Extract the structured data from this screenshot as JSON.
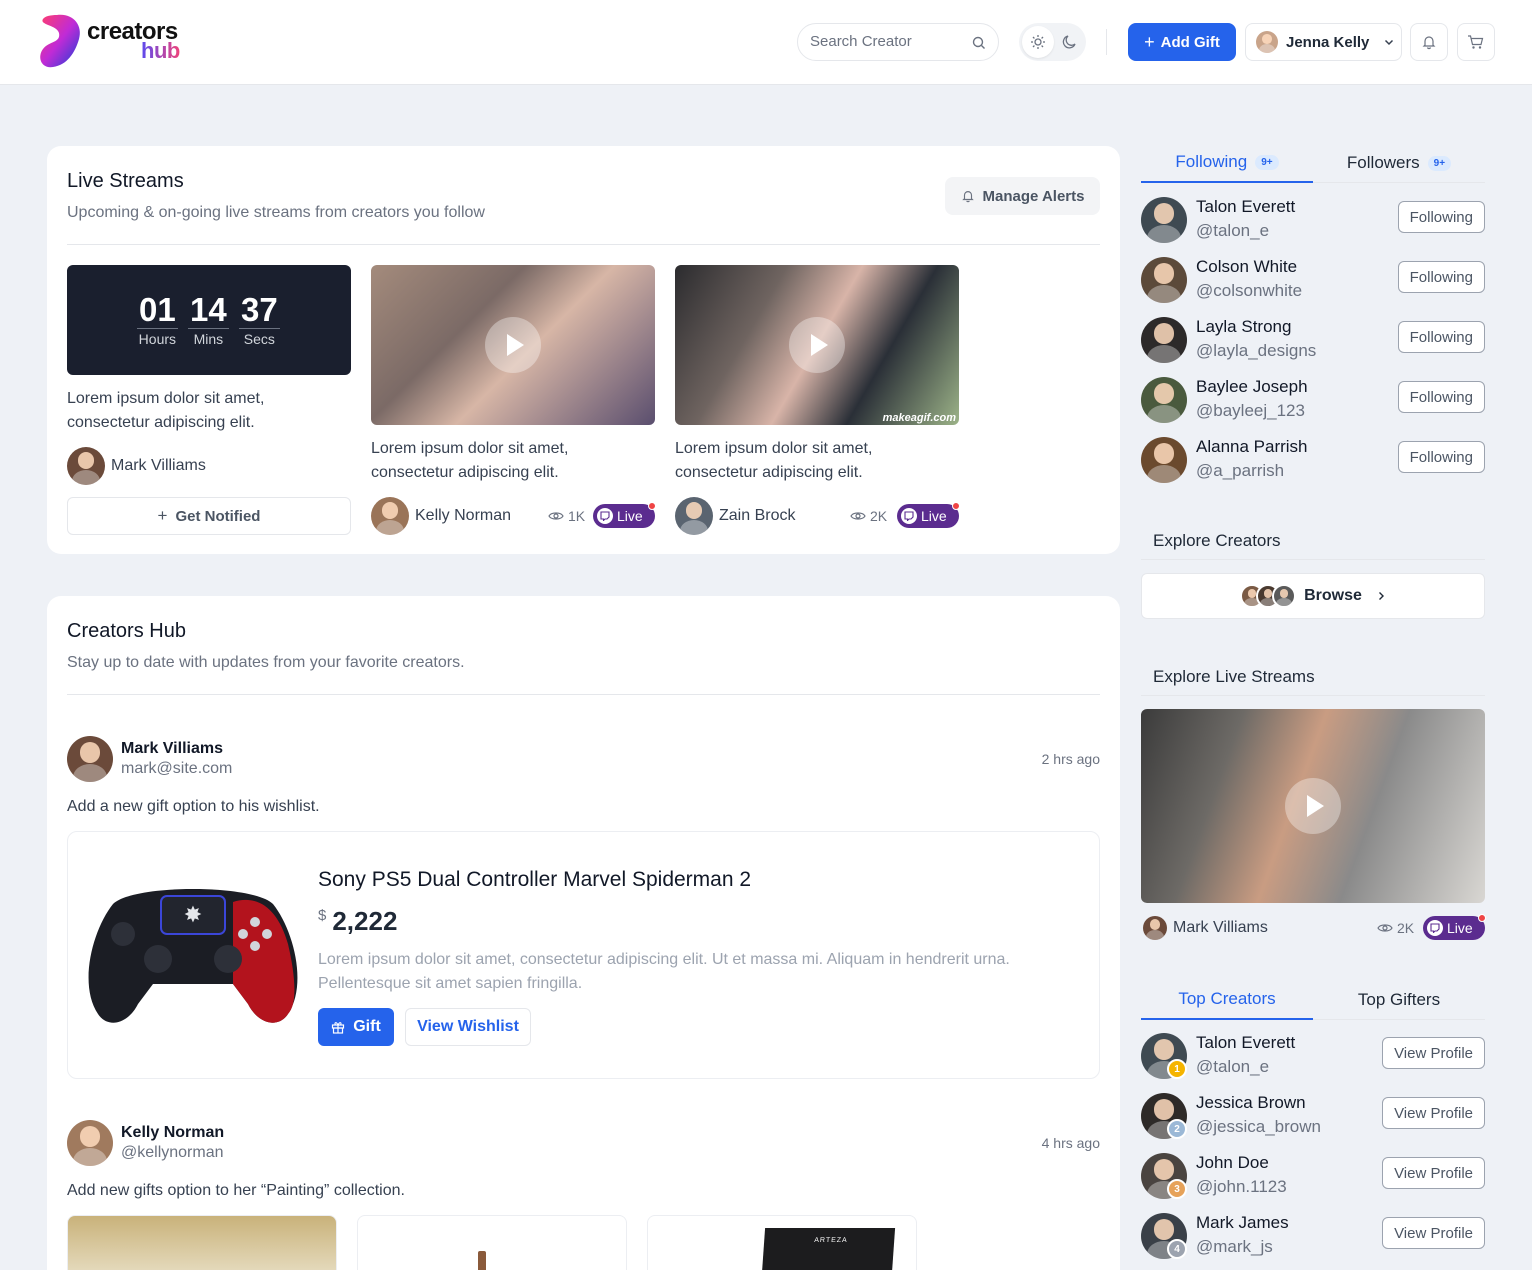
{
  "header": {
    "logo_line1": "creators",
    "logo_line2": "hub",
    "search_placeholder": "Search Creator",
    "add_gift_label": "Add Gift",
    "user_name": "Jenna Kelly",
    "icons": [
      "search-icon",
      "sun-icon",
      "moon-icon",
      "plus-icon",
      "chevron-down-icon",
      "bell-icon",
      "cart-icon"
    ]
  },
  "live_streams": {
    "title": "Live Streams",
    "subtitle": "Upcoming & on-going live streams from creators you follow",
    "manage_alerts_label": "Manage Alerts",
    "countdown": {
      "hours": "01",
      "mins": "14",
      "secs": "37",
      "hours_label": "Hours",
      "mins_label": "Mins",
      "secs_label": "Secs"
    },
    "upcoming": {
      "desc": "Lorem ipsum dolor sit amet, consectetur adipiscing elit.",
      "creator": "Mark Villiams",
      "notify_label": "Get Notified"
    },
    "streams": [
      {
        "desc": "Lorem ipsum dolor sit amet, consectetur adipiscing elit.",
        "creator": "Kelly Norman",
        "views": "1K",
        "live_label": "Live"
      },
      {
        "desc": "Lorem ipsum dolor sit amet, consectetur adipiscing elit.",
        "creator": "Zain Brock",
        "views": "2K",
        "live_label": "Live",
        "watermark": "makeagif.com"
      }
    ]
  },
  "creators_hub": {
    "title": "Creators Hub",
    "subtitle": "Stay up to date with updates from your favorite creators.",
    "posts": [
      {
        "name": "Mark Villiams",
        "handle": "mark@site.com",
        "time": "2 hrs ago",
        "text": "Add a new gift option to his wishlist.",
        "product": {
          "title": "Sony PS5 Dual Controller Marvel Spiderman 2",
          "currency": "$",
          "price": "2,222",
          "desc": "Lorem ipsum dolor sit amet, consectetur adipiscing elit. Ut et massa mi. Aliquam in hendrerit urna. Pellentesque sit amet sapien fringilla.",
          "gift_label": "Gift",
          "wishlist_label": "View Wishlist"
        }
      },
      {
        "name": "Kelly Norman",
        "handle": "@kellynorman",
        "time": "4 hrs ago",
        "text": "Add new gifts option to her “Painting” collection.",
        "gallery_text": "ARTEZA"
      }
    ]
  },
  "sidebar": {
    "tabs": [
      {
        "label": "Following",
        "count": "9+"
      },
      {
        "label": "Followers",
        "count": "9+"
      }
    ],
    "following": [
      {
        "name": "Talon Everett",
        "handle": "@talon_e",
        "button": "Following"
      },
      {
        "name": "Colson White",
        "handle": "@colsonwhite",
        "button": "Following"
      },
      {
        "name": "Layla Strong",
        "handle": "@layla_designs",
        "button": "Following"
      },
      {
        "name": "Baylee Joseph",
        "handle": "@bayleej_123",
        "button": "Following"
      },
      {
        "name": "Alanna Parrish",
        "handle": "@a_parrish",
        "button": "Following"
      }
    ],
    "explore_creators_title": "Explore Creators",
    "browse_label": "Browse",
    "explore_streams_title": "Explore Live Streams",
    "featured_stream": {
      "creator": "Mark Villiams",
      "views": "2K",
      "live_label": "Live"
    },
    "top_tabs": [
      {
        "label": "Top Creators"
      },
      {
        "label": "Top Gifters"
      }
    ],
    "top_creators": [
      {
        "name": "Talon Everett",
        "handle": "@talon_e",
        "rank": "1",
        "button": "View Profile"
      },
      {
        "name": "Jessica Brown",
        "handle": "@jessica_brown",
        "rank": "2",
        "button": "View Profile"
      },
      {
        "name": "John Doe",
        "handle": "@john.1123",
        "rank": "3",
        "button": "View Profile"
      },
      {
        "name": "Mark James",
        "handle": "@mark_js",
        "rank": "4",
        "button": "View Profile"
      }
    ]
  },
  "colors": {
    "primary": "#2563eb",
    "live": "#5b2c8f",
    "countdown_bg": "#1a1f2e",
    "page_bg": "#eef1f6"
  }
}
